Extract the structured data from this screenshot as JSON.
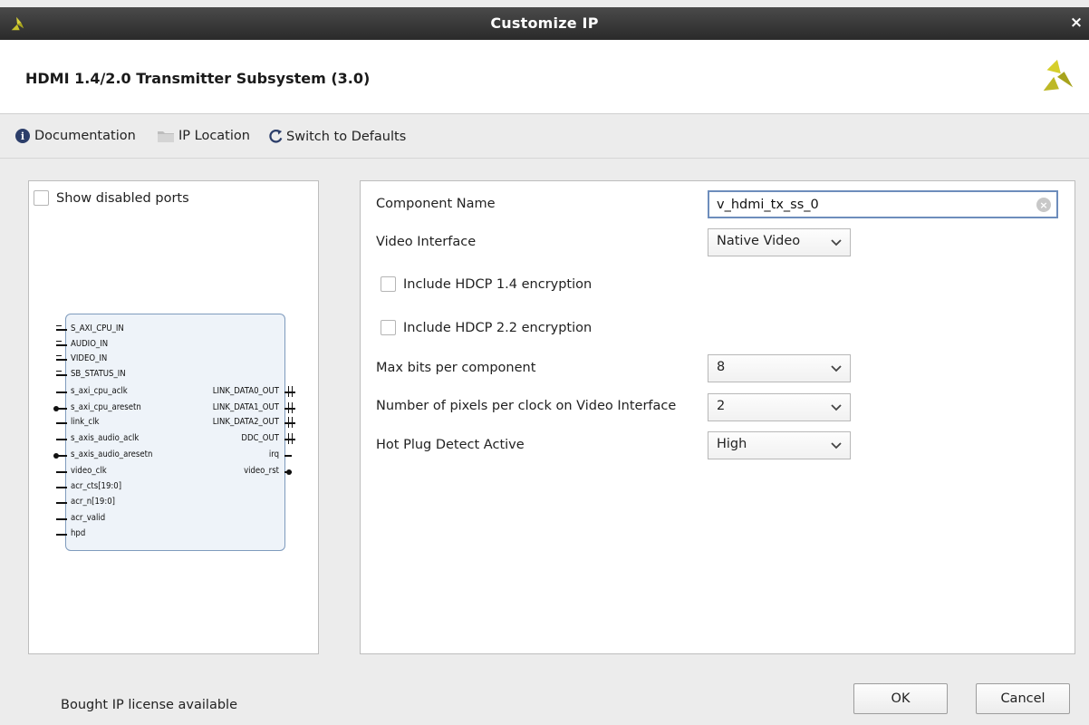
{
  "window": {
    "title": "Customize IP"
  },
  "header": {
    "ip_title": "HDMI 1.4/2.0 Transmitter Subsystem (3.0)"
  },
  "toolbar": {
    "documentation": "Documentation",
    "ip_location": "IP Location",
    "switch_defaults": "Switch to Defaults"
  },
  "symbol_panel": {
    "show_disabled_ports": "Show disabled ports",
    "left_ports": [
      "S_AXI_CPU_IN",
      "AUDIO_IN",
      "VIDEO_IN",
      "SB_STATUS_IN",
      "s_axi_cpu_aclk",
      "s_axi_cpu_aresetn",
      "link_clk",
      "s_axis_audio_aclk",
      "s_axis_audio_aresetn",
      "video_clk",
      "acr_cts[19:0]",
      "acr_n[19:0]",
      "acr_valid",
      "hpd"
    ],
    "right_ports": [
      "LINK_DATA0_OUT",
      "LINK_DATA1_OUT",
      "LINK_DATA2_OUT",
      "DDC_OUT",
      "irq",
      "video_rst"
    ]
  },
  "config": {
    "component_name_label": "Component Name",
    "component_name_value": "v_hdmi_tx_ss_0",
    "video_interface_label": "Video Interface",
    "video_interface_value": "Native Video",
    "hdcp14_label": "Include HDCP 1.4 encryption",
    "hdcp22_label": "Include HDCP 2.2 encryption",
    "max_bits_label": "Max bits per component",
    "max_bits_value": "8",
    "pixels_label": "Number of pixels per clock on Video Interface",
    "pixels_value": "2",
    "hpd_label": "Hot Plug Detect Active",
    "hpd_value": "High"
  },
  "footer": {
    "license": "Bought IP license available",
    "ok": "OK",
    "cancel": "Cancel"
  },
  "colors": {
    "titlebar": "#333333",
    "accent_input_border": "#6d8dbc",
    "logo_yellow": "#c7c22a",
    "block_fill": "#eef3f9"
  },
  "icons": {
    "app": "xilinx-logo-icon",
    "info": "info-icon",
    "folder": "folder-icon",
    "refresh": "refresh-icon",
    "close": "close-icon",
    "clear": "clear-icon",
    "dropdown": "chevron-down-icon"
  }
}
